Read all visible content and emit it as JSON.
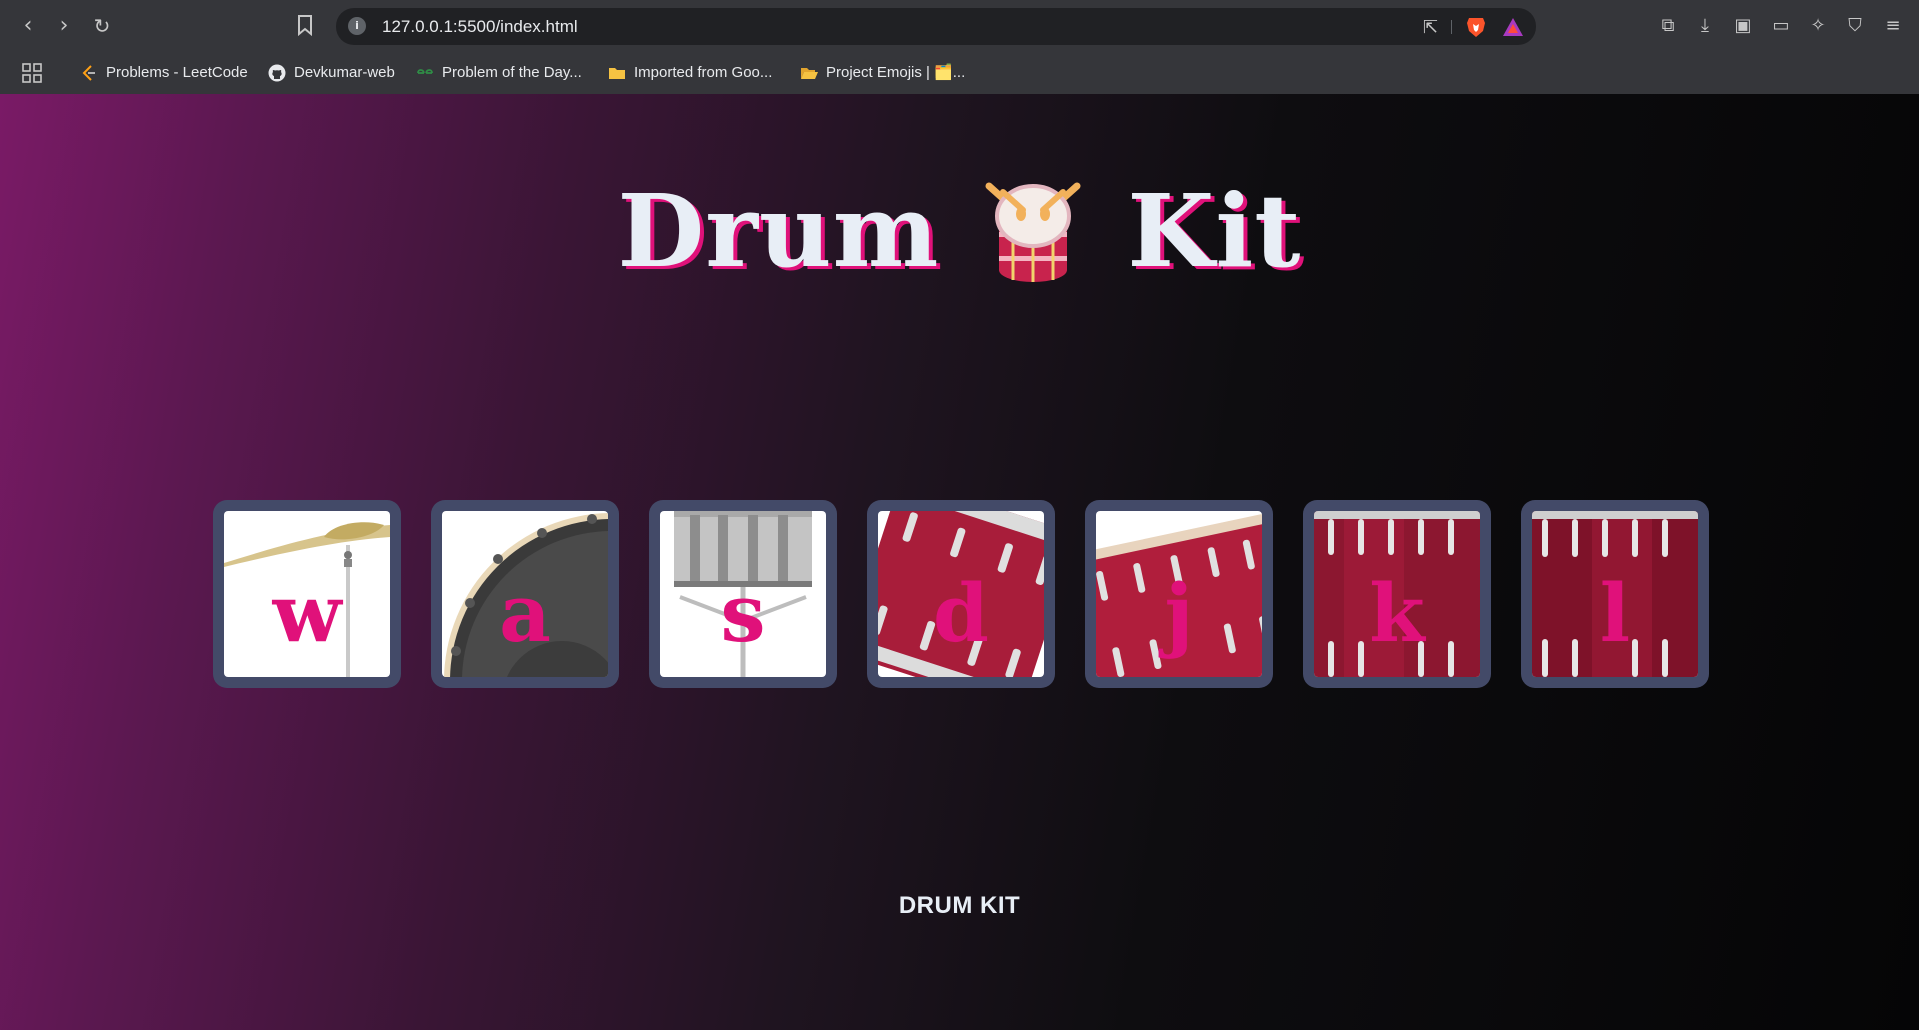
{
  "browser": {
    "url": "127.0.0.1:5500/index.html",
    "bookmarks": [
      {
        "label": "Problems - LeetCode",
        "icon": "leetcode-icon"
      },
      {
        "label": "Devkumar-web",
        "icon": "github-icon"
      },
      {
        "label": "Problem of the Day...",
        "icon": "geeksforgeeks-icon"
      },
      {
        "label": "Imported from Goo...",
        "icon": "folder-icon"
      },
      {
        "label": "Project Emojis | 🗂️...",
        "icon": "folder-open-icon"
      }
    ]
  },
  "page": {
    "title_left": "Drum",
    "title_right": "Kit",
    "footer": "DRUM KIT",
    "accent_color": "#e0117a",
    "key_frame_color": "#434a68",
    "keys": [
      {
        "letter": "w",
        "instrument": "crash-cymbal"
      },
      {
        "letter": "a",
        "instrument": "kick-drum"
      },
      {
        "letter": "s",
        "instrument": "snare-drum"
      },
      {
        "letter": "d",
        "instrument": "tom-1"
      },
      {
        "letter": "j",
        "instrument": "tom-2"
      },
      {
        "letter": "k",
        "instrument": "tom-3"
      },
      {
        "letter": "l",
        "instrument": "tom-4"
      }
    ]
  }
}
